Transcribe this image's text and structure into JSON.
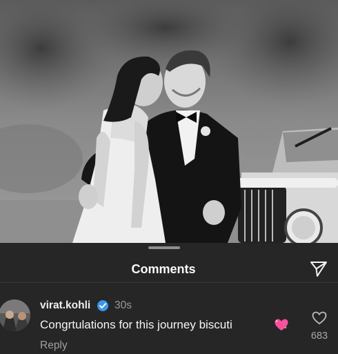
{
  "post": {
    "photo_icon": "wedding-photo"
  },
  "comments_sheet": {
    "title": "Comments",
    "share_icon": "send-icon"
  },
  "comment": {
    "username": "virat.kohli",
    "verified_icon": "verified-badge-icon",
    "time": "30s",
    "text": "Congrtulations for this journey biscuti",
    "emoji": "sparkling-heart-icon",
    "reply_label": "Reply",
    "like_icon": "heart-outline-icon",
    "like_count": "683"
  },
  "colors": {
    "background": "#262626",
    "verified": "#3897f0",
    "emoji": "#ff4fa0"
  }
}
